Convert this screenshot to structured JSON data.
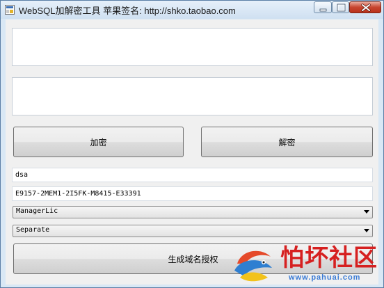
{
  "window": {
    "title": "WebSQL加解密工具 苹果签名: http://shko.taobao.com"
  },
  "colors": {
    "window_frame": "#d9e8f5",
    "client_background": "#f0f0f0",
    "close_button": "#c7452f",
    "watermark_red": "#d62020",
    "watermark_blue": "#3a7bd5"
  },
  "form": {
    "input_text": "",
    "output_text": "",
    "encrypt_label": "加密",
    "decrypt_label": "解密",
    "name_value": "dsa",
    "serial_value": "E9157-2MEM1-2I5FK-M8415-E33391",
    "license_type_selected": "ManagerLic",
    "mode_selected": "Separate",
    "generate_label": "生成域名授权"
  },
  "watermark": {
    "brand": "怕坏社区",
    "url": "www.pahuai.com"
  }
}
